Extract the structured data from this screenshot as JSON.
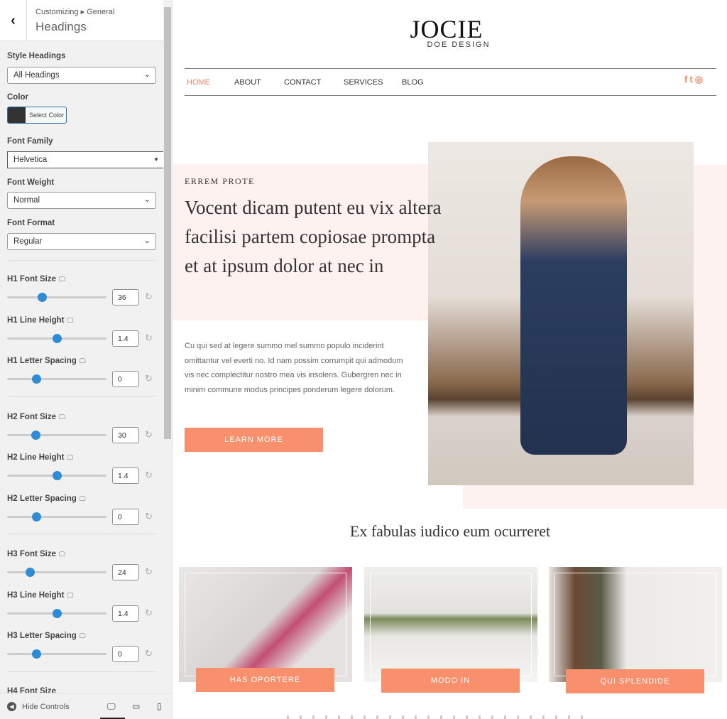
{
  "sidebar": {
    "breadcrumb": "Customizing ▸ General",
    "title": "Headings",
    "style_headings": {
      "label": "Style Headings",
      "value": "All Headings"
    },
    "color": {
      "label": "Color",
      "button": "Select Color",
      "swatch": "#333333"
    },
    "font_family": {
      "label": "Font Family",
      "value": "Helvetica"
    },
    "font_weight": {
      "label": "Font Weight",
      "value": "Normal"
    },
    "font_format": {
      "label": "Font Format",
      "value": "Regular"
    },
    "sliders": [
      {
        "label": "H1 Font Size",
        "value": "36"
      },
      {
        "label": "H1 Line Height",
        "value": "1.4"
      },
      {
        "label": "H1 Letter Spacing",
        "value": "0"
      },
      {
        "label": "H2 Font Size",
        "value": "30"
      },
      {
        "label": "H2 Line Height",
        "value": "1.4"
      },
      {
        "label": "H2 Letter Spacing",
        "value": "0"
      },
      {
        "label": "H3 Font Size",
        "value": "24"
      },
      {
        "label": "H3 Line Height",
        "value": "1.4"
      },
      {
        "label": "H3 Letter Spacing",
        "value": "0"
      }
    ],
    "next_label": "H4 Font Size",
    "hide_controls": "Hide Controls",
    "accent": "#2e8bd6"
  },
  "site": {
    "logo_main": "JOCIE",
    "logo_sub": "DOE DESIGN",
    "nav": [
      "HOME",
      "ABOUT",
      "CONTACT",
      "SERVICES",
      "BLOG"
    ],
    "active_nav": "HOME",
    "social": [
      "facebook-icon",
      "twitter-icon",
      "instagram-icon"
    ],
    "hero": {
      "kicker": "ERREM PROTE",
      "heading": "Vocent dicam putent eu vix altera facilisi partem copiosae prompta et at ipsum dolor at nec in",
      "body": "Cu qui sed at legere summo mel summo populo inciderint omittantur vel everti no. Id nam possim corrumpit qui admodum vis nec complectitur nostro mea vis insolens. Gubergren nec in minim commune modus principes ponderum legere dolorum.",
      "button": "LEARN MORE"
    },
    "section_title": "Ex fabulas iudico eum ocurreret",
    "cards": [
      {
        "label": "HAS OPORTERE"
      },
      {
        "label": "MODO IN"
      },
      {
        "label": "QUI SPLENDIDE"
      }
    ],
    "accent": "#f88f6d"
  }
}
